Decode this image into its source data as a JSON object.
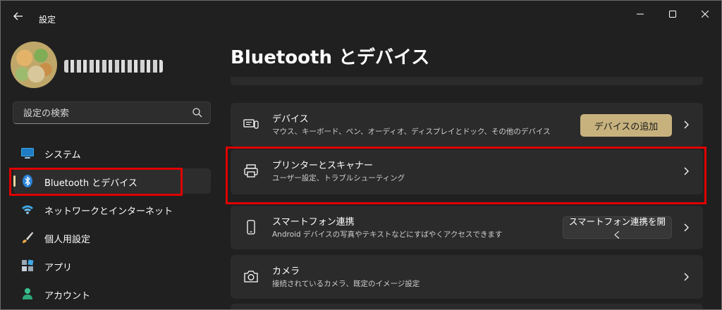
{
  "window": {
    "title": "設定",
    "controls": [
      "minimize-icon",
      "maximize-icon",
      "close-icon"
    ]
  },
  "search": {
    "placeholder": "設定の検索",
    "icon": "search-icon"
  },
  "sidebar": {
    "items": [
      {
        "label": "システム",
        "icon": "monitor-icon"
      },
      {
        "label": "Bluetooth とデバイス",
        "icon": "bluetooth-icon",
        "selected": true
      },
      {
        "label": "ネットワークとインターネット",
        "icon": "wifi-icon"
      },
      {
        "label": "個人用設定",
        "icon": "paintbrush-icon"
      },
      {
        "label": "アプリ",
        "icon": "apps-icon"
      },
      {
        "label": "アカウント",
        "icon": "account-icon"
      }
    ]
  },
  "main": {
    "title": "Bluetooth とデバイス",
    "cards": [
      {
        "title": "デバイス",
        "subtitle": "マウス、キーボード、ペン、オーディオ、ディスプレイとドック、その他のデバイス",
        "button": "デバイスの追加",
        "icon": "devices-icon"
      },
      {
        "title": "プリンターとスキャナー",
        "subtitle": "ユーザー設定、トラブルシューティング",
        "icon": "printer-icon"
      },
      {
        "title": "スマートフォン連携",
        "subtitle": "Android デバイスの写真やテキストなどにすばやくアクセスできます",
        "button": "スマートフォン連携を開く",
        "icon": "phone-icon"
      },
      {
        "title": "カメラ",
        "subtitle": "接続されているカメラ、既定のイメージ設定",
        "icon": "camera-icon"
      }
    ]
  },
  "colors": {
    "accent": "#c7b27e",
    "highlight": "#e00000",
    "indicator": "#e9d79e",
    "background": "#202020",
    "card": "#2b2b2b"
  }
}
